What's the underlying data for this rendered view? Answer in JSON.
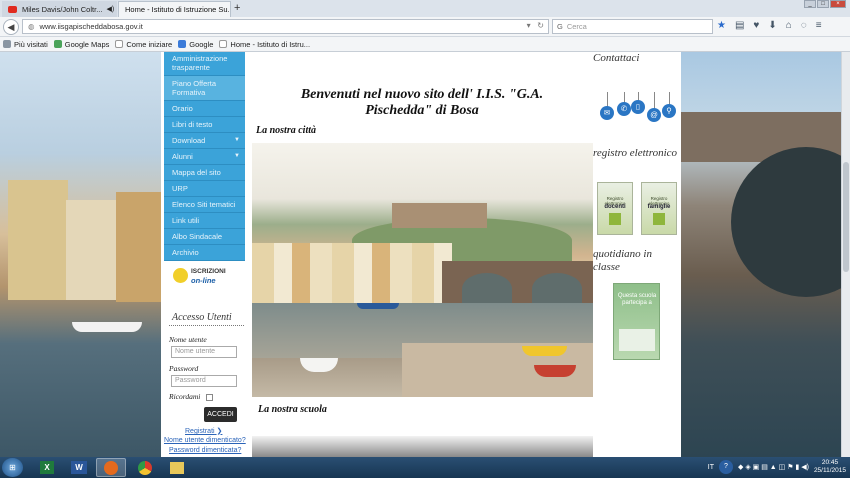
{
  "browser": {
    "tabs": [
      {
        "label": "Miles Davis/John Coltr...",
        "active": false
      },
      {
        "label": "Home - Istituto di Istruzione Su...",
        "active": true
      }
    ],
    "url": "www.iisgapischeddabosa.gov.it",
    "search_placeholder": "Cerca",
    "bookmarks": [
      "Più visitati",
      "Google Maps",
      "Come iniziare",
      "Google",
      "Home - Istituto di Istru..."
    ]
  },
  "sidebar": {
    "menu": [
      {
        "label": "Amministrazione trasparente",
        "has_children": false
      },
      {
        "label": "Piano Offerta Formativa",
        "has_children": false
      },
      {
        "label": "Orario",
        "has_children": false
      },
      {
        "label": "Libri di testo",
        "has_children": false
      },
      {
        "label": "Download",
        "has_children": true
      },
      {
        "label": "Alunni",
        "has_children": true
      },
      {
        "label": "Mappa del sito",
        "has_children": false
      },
      {
        "label": "URP",
        "has_children": false
      },
      {
        "label": "Elenco Siti tematici",
        "has_children": false
      },
      {
        "label": "Link utili",
        "has_children": false
      },
      {
        "label": "Albo Sindacale",
        "has_children": false
      },
      {
        "label": "Archivio",
        "has_children": false
      }
    ],
    "iscrizioni": {
      "line1": "ISCRIZIONI",
      "line2": "on-line"
    },
    "login": {
      "title": "Accesso Utenti",
      "username_label": "Nome utente",
      "username_placeholder": "Nome utente",
      "password_label": "Password",
      "password_placeholder": "Password",
      "remember_label": "Ricordami",
      "submit_label": "ACCEDI",
      "register_link": "Registrati",
      "forgot_username_link": "Nome utente dimenticato?",
      "forgot_password_link": "Password dimenticata?"
    }
  },
  "main": {
    "heading": "Benvenuti nel nuovo sito dell' I.I.S. \"G.A. Pischedda\" di Bosa",
    "section_city": "La nostra città",
    "section_school": "La nostra scuola"
  },
  "right": {
    "contacts_title": "Contattaci",
    "contact_icons": [
      "envelope-icon",
      "phone-icon",
      "mobile-icon",
      "at-icon",
      "location-pin-icon"
    ],
    "registro_title": "registro elettronico",
    "registro_docenti": {
      "small": "Registro elettronico",
      "label": "docenti"
    },
    "registro_famiglie": {
      "small": "Registro elettronico",
      "label": "famiglie"
    },
    "quotidiano_title": "quotidiano in classe",
    "quotidiano_banner": "Questa scuola partecipa a"
  },
  "taskbar": {
    "apps": [
      "Excel",
      "Word",
      "Firefox",
      "Chrome",
      "Esplora risorse"
    ],
    "language": "IT",
    "time": "20:45",
    "date": "25/11/2015"
  },
  "colors": {
    "menu_blue": "#3ba3d9",
    "accent_link": "#2a63b8",
    "button_dark": "#2b2b2b"
  }
}
